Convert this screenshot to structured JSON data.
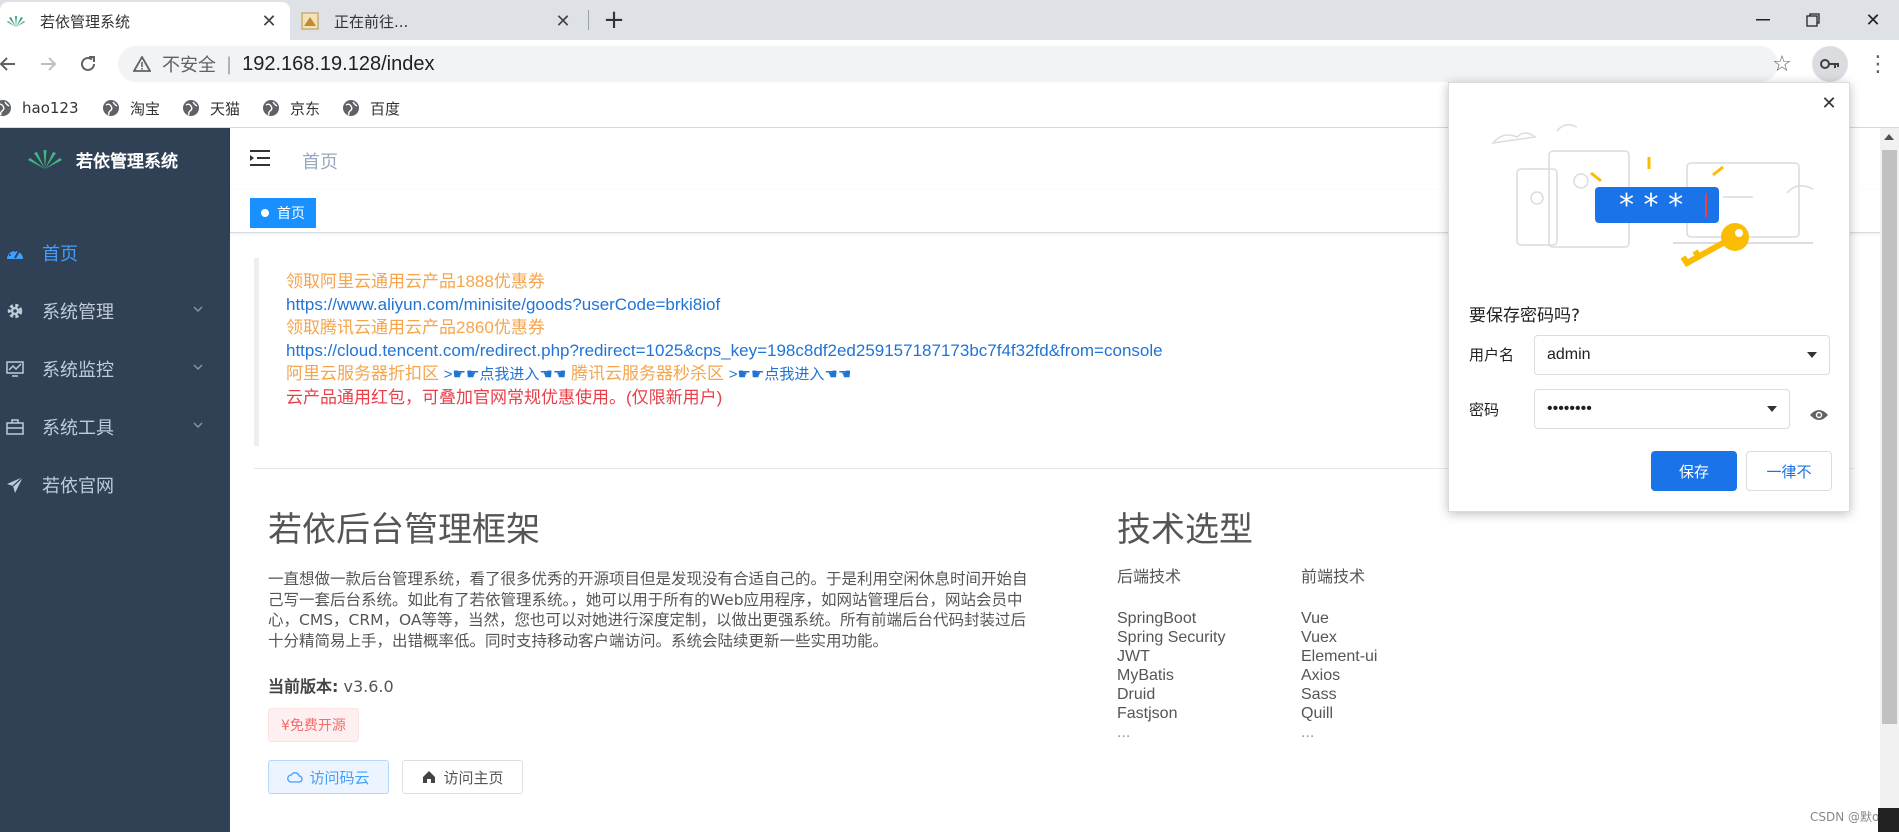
{
  "browser": {
    "tabs": [
      {
        "title": "若依管理系统",
        "favicon": "ruoyi-leaf-icon",
        "active": true
      },
      {
        "title": "正在前往...",
        "favicon": "loading-image-icon",
        "active": false
      }
    ],
    "address": {
      "insecure_label": "不安全",
      "url": "192.168.19.128/index"
    },
    "bookmarks": [
      {
        "label": "hao123",
        "icon": "globe-icon"
      },
      {
        "label": "淘宝",
        "icon": "globe-icon"
      },
      {
        "label": "天猫",
        "icon": "globe-icon"
      },
      {
        "label": "京东",
        "icon": "globe-icon"
      },
      {
        "label": "百度",
        "icon": "globe-icon"
      }
    ]
  },
  "app": {
    "logo_title": "若依管理系统",
    "sidebar": {
      "items": [
        {
          "label": "首页",
          "icon": "dashboard-icon",
          "active": true,
          "expandable": false
        },
        {
          "label": "系统管理",
          "icon": "gear-icon",
          "active": false,
          "expandable": true
        },
        {
          "label": "系统监控",
          "icon": "monitor-icon",
          "active": false,
          "expandable": true
        },
        {
          "label": "系统工具",
          "icon": "toolbox-icon",
          "active": false,
          "expandable": true
        },
        {
          "label": "若依官网",
          "icon": "send-icon",
          "active": false,
          "expandable": false
        }
      ]
    },
    "breadcrumb": "首页",
    "tags": [
      {
        "label": "首页",
        "active": true
      }
    ],
    "promo": {
      "aliyun_coupon": "领取阿里云通用云产品1888优惠券",
      "aliyun_url": "https://www.aliyun.com/minisite/goods?userCode=brki8iof",
      "tencent_coupon": "领取腾讯云通用云产品2860优惠券",
      "tencent_url": "https://cloud.tencent.com/redirect.php?redirect=1025&cps_key=198c8df2ed259157187173bc7f4f32fd&from=console",
      "aliyun_discount": "阿里云服务器折扣区",
      "enter_link_1": ">☛☛点我进入☚☚",
      "tencent_flash": "腾讯云服务器秒杀区",
      "enter_link_2": ">☛☛点我进入☚☚",
      "red_note": "云产品通用红包，可叠加官网常规优惠使用。(仅限新用户)"
    },
    "intro": {
      "title": "若依后台管理框架",
      "description": "一直想做一款后台管理系统，看了很多优秀的开源项目但是发现没有合适自己的。于是利用空闲休息时间开始自己写一套后台系统。如此有了若依管理系统。，她可以用于所有的Web应用程序，如网站管理后台，网站会员中心，CMS，CRM，OA等等，当然，您也可以对她进行深度定制，以做出更强系统。所有前端后台代码封装过后十分精简易上手，出错概率低。同时支持移动客户端访问。系统会陆续更新一些实用功能。",
      "version_label": "当前版本:",
      "version_value": "v3.6.0",
      "free_tag": "¥免费开源",
      "btn_gitee": "访问码云",
      "btn_home": "访问主页"
    },
    "tech": {
      "title": "技术选型",
      "backend_title": "后端技术",
      "backend": [
        "SpringBoot",
        "Spring Security",
        "JWT",
        "MyBatis",
        "Druid",
        "Fastjson",
        "..."
      ],
      "frontend_title": "前端技术",
      "frontend": [
        "Vue",
        "Vuex",
        "Element-ui",
        "Axios",
        "Sass",
        "Quill",
        "..."
      ]
    },
    "watermark": "CSDN @默o."
  },
  "password_dialog": {
    "title": "要保存密码吗?",
    "username_label": "用户名",
    "username_value": "admin",
    "password_label": "密码",
    "password_value": "••••••••",
    "save_label": "保存",
    "never_label": "一律不"
  },
  "colors": {
    "sidebar_bg": "#304156",
    "accent": "#409eff",
    "chrome_blue": "#1a73e8",
    "promo_orange": "#f5a54c",
    "promo_red": "#e8404a"
  }
}
